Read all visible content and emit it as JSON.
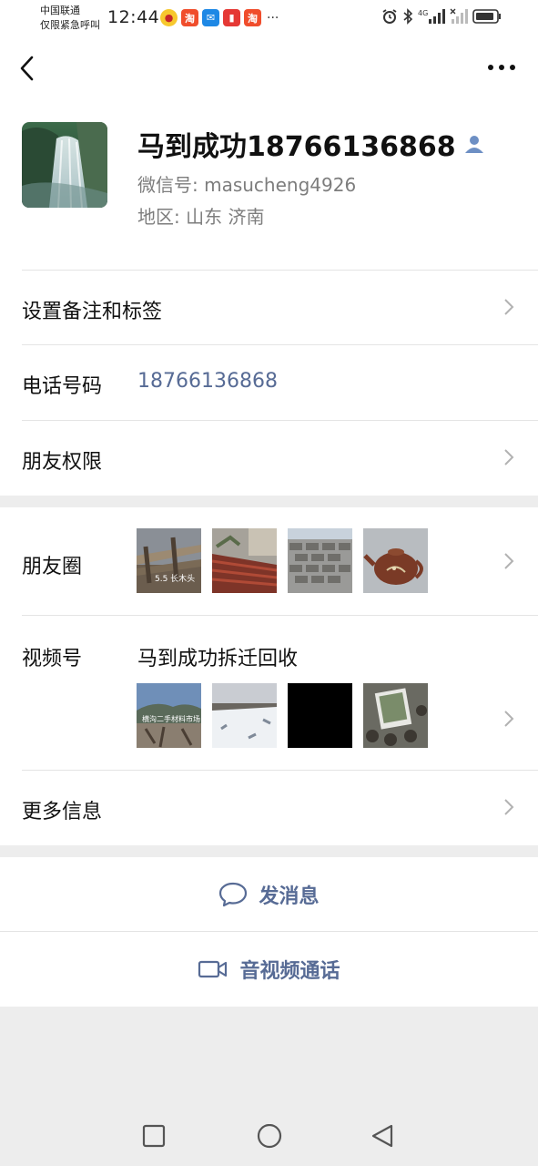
{
  "status_bar": {
    "carrier_line1": "中国联通",
    "carrier_line2": "仅限紧急呼叫",
    "time": "12:44",
    "notif_tao": "淘",
    "notif_overflow": "···",
    "network_label": "4G"
  },
  "nav": {
    "back_icon": "chevron-left-icon",
    "more_icon": "more-dots-icon"
  },
  "profile": {
    "name": "马到成功18766136868",
    "wechat_id": "微信号: masucheng4926",
    "region": "地区: 山东  济南",
    "avatar_icon": "waterfall-photo"
  },
  "rows": {
    "remark_label": "设置备注和标签",
    "phone_label": "电话号码",
    "phone_value": "18766136868",
    "permission_label": "朋友权限",
    "moments_label": "朋友圈",
    "channels_label": "视频号",
    "channels_name": "马到成功拆迁回收",
    "more_info_label": "更多信息"
  },
  "moments_thumbs": [
    {
      "caption": "5.5 长木头",
      "icon": "wood-pile-photo"
    },
    {
      "caption": "",
      "icon": "red-steel-photo"
    },
    {
      "caption": "",
      "icon": "brick-stack-photo"
    },
    {
      "caption": "",
      "icon": "teapot-photo"
    }
  ],
  "channels_thumbs": [
    {
      "caption": "横沟二手材料市场",
      "icon": "market-photo"
    },
    {
      "caption": "",
      "icon": "snow-yard-photo"
    },
    {
      "caption": "",
      "icon": "black-video-thumb"
    },
    {
      "caption": "",
      "icon": "pots-photo"
    }
  ],
  "actions": {
    "message_label": "发消息",
    "call_label": "音视频通话"
  },
  "colors": {
    "link": "#576b95",
    "background": "#ededed",
    "panel": "#ffffff"
  }
}
